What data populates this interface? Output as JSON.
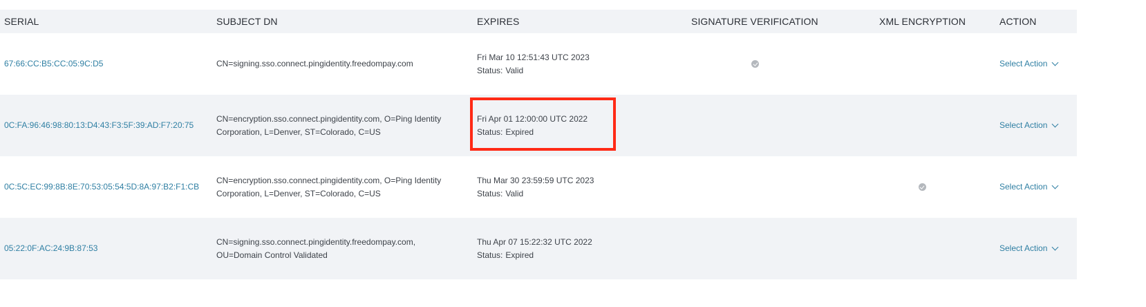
{
  "columns": {
    "serial": "SERIAL",
    "subject_dn": "SUBJECT DN",
    "expires": "EXPIRES",
    "signature_verification": "SIGNATURE VERIFICATION",
    "xml_encryption": "XML ENCRYPTION",
    "action": "ACTION"
  },
  "status_label": "Status:",
  "rows": [
    {
      "serial": "67:66:CC:B5:CC:05:9C:D5",
      "subject_line1": "CN=signing.sso.connect.pingidentity.freedompay.com",
      "subject_line2": "",
      "expires": "Fri Mar 10 12:51:43 UTC 2023",
      "status": "Valid",
      "signature_verification": true,
      "xml_encryption": false,
      "action": "Select Action"
    },
    {
      "serial": "0C:FA:96:46:98:80:13:D4:43:F3:5F:39:AD:F7:20:75",
      "subject_line1": "CN=encryption.sso.connect.pingidentity.com, O=Ping Identity",
      "subject_line2": "Corporation, L=Denver, ST=Colorado, C=US",
      "expires": "Fri Apr 01 12:00:00 UTC 2022",
      "status": "Expired",
      "signature_verification": false,
      "xml_encryption": false,
      "action": "Select Action",
      "highlighted": true
    },
    {
      "serial": "0C:5C:EC:99:8B:8E:70:53:05:54:5D:8A:97:B2:F1:CB",
      "subject_line1": "CN=encryption.sso.connect.pingidentity.com, O=Ping Identity",
      "subject_line2": "Corporation, L=Denver, ST=Colorado, C=US",
      "expires": "Thu Mar 30 23:59:59 UTC 2023",
      "status": "Valid",
      "signature_verification": false,
      "xml_encryption": true,
      "action": "Select Action"
    },
    {
      "serial": "05:22:0F:AC:24:9B:87:53",
      "subject_line1": "CN=signing.sso.connect.pingidentity.freedompay.com,",
      "subject_line2": "OU=Domain Control Validated",
      "expires": "Thu Apr 07 15:22:32 UTC 2022",
      "status": "Expired",
      "signature_verification": false,
      "xml_encryption": false,
      "action": "Select Action"
    }
  ],
  "icons": {
    "check": "check-circle-icon",
    "chevron": "chevron-down-icon"
  },
  "colors": {
    "link": "#2f7fa3",
    "header_bg": "#f1f3f6",
    "alt_row_bg": "#f1f3f6",
    "highlight": "#ff2a16",
    "check": "#b4b8bd"
  }
}
